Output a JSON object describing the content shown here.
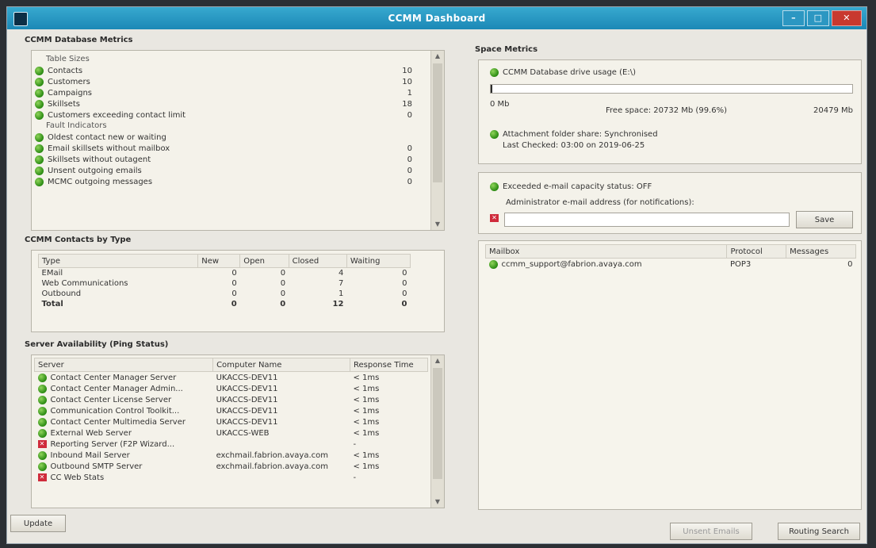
{
  "window": {
    "title": "CCMM Dashboard"
  },
  "db_metrics": {
    "title": "CCMM Database Metrics",
    "table_sizes_label": "Table Sizes",
    "table_sizes": [
      {
        "label": "Contacts",
        "value": "10"
      },
      {
        "label": "Customers",
        "value": "10"
      },
      {
        "label": "Campaigns",
        "value": "1"
      },
      {
        "label": "Skillsets",
        "value": "18"
      },
      {
        "label": "Customers exceeding contact limit",
        "value": "0"
      }
    ],
    "fault_label": "Fault Indicators",
    "faults": [
      {
        "label": "Oldest contact new or waiting",
        "value": ""
      },
      {
        "label": "Email skillsets without mailbox",
        "value": "0"
      },
      {
        "label": "Skillsets without outagent",
        "value": "0"
      },
      {
        "label": "Unsent outgoing emails",
        "value": "0"
      },
      {
        "label": "MCMC outgoing messages",
        "value": "0"
      }
    ]
  },
  "contacts_by_type": {
    "title": "CCMM Contacts by Type",
    "columns": [
      "Type",
      "New",
      "Open",
      "Closed",
      "Waiting"
    ],
    "rows": [
      {
        "type": "EMail",
        "new": "0",
        "open": "0",
        "closed": "4",
        "waiting": "0"
      },
      {
        "type": "Web Communications",
        "new": "0",
        "open": "0",
        "closed": "7",
        "waiting": "0"
      },
      {
        "type": "Outbound",
        "new": "0",
        "open": "0",
        "closed": "1",
        "waiting": "0"
      },
      {
        "type": "Total",
        "new": "0",
        "open": "0",
        "closed": "12",
        "waiting": "0"
      }
    ]
  },
  "server_availability": {
    "title": "Server Availability (Ping Status)",
    "columns": [
      "Server",
      "Computer Name",
      "Response Time"
    ],
    "rows": [
      {
        "status": "ok",
        "server": "Contact Center Manager Server",
        "computer": "UKACCS-DEV11",
        "time": "< 1ms"
      },
      {
        "status": "ok",
        "server": "Contact Center Manager Admin...",
        "computer": "UKACCS-DEV11",
        "time": "< 1ms"
      },
      {
        "status": "ok",
        "server": "Contact Center License Server",
        "computer": "UKACCS-DEV11",
        "time": "< 1ms"
      },
      {
        "status": "ok",
        "server": "Communication Control Toolkit...",
        "computer": "UKACCS-DEV11",
        "time": "< 1ms"
      },
      {
        "status": "ok",
        "server": "Contact Center Multimedia Server",
        "computer": "UKACCS-DEV11",
        "time": "< 1ms"
      },
      {
        "status": "ok",
        "server": "External Web Server",
        "computer": "UKACCS-WEB",
        "time": "< 1ms"
      },
      {
        "status": "err",
        "server": "Reporting Server (F2P Wizard...",
        "computer": "",
        "time": "-"
      },
      {
        "status": "ok",
        "server": "Inbound Mail Server",
        "computer": "exchmail.fabrion.avaya.com",
        "time": "< 1ms"
      },
      {
        "status": "ok",
        "server": "Outbound SMTP Server",
        "computer": "exchmail.fabrion.avaya.com",
        "time": "< 1ms"
      },
      {
        "status": "err",
        "server": "CC Web Stats",
        "computer": "",
        "time": "-"
      }
    ]
  },
  "space_metrics": {
    "title": "Space Metrics",
    "db_volume_label": "CCMM Database drive usage (E:\\)",
    "usage_percent": 0,
    "left_label": "0 Mb",
    "free_space_label": "Free space: 20732 Mb (99.6%)",
    "right_label": "20479 Mb",
    "attachment_label": "Attachment folder share: Synchronised",
    "last_checked_label": "Last Checked: 03:00 on 2019-06-25"
  },
  "email_alert": {
    "status_label": "Exceeded e-mail capacity status: OFF",
    "admin_label": "Administrator e-mail address (for notifications):",
    "email_value": "",
    "save_label": "Save"
  },
  "mailboxes": {
    "columns": [
      "Mailbox",
      "Protocol",
      "Messages"
    ],
    "rows": [
      {
        "mailbox": "ccmm_support@fabrion.avaya.com",
        "protocol": "POP3",
        "messages": "0"
      }
    ]
  },
  "footer": {
    "update_label": "Update",
    "unsent_label": "Unsent Emails",
    "routing_label": "Routing Search"
  }
}
